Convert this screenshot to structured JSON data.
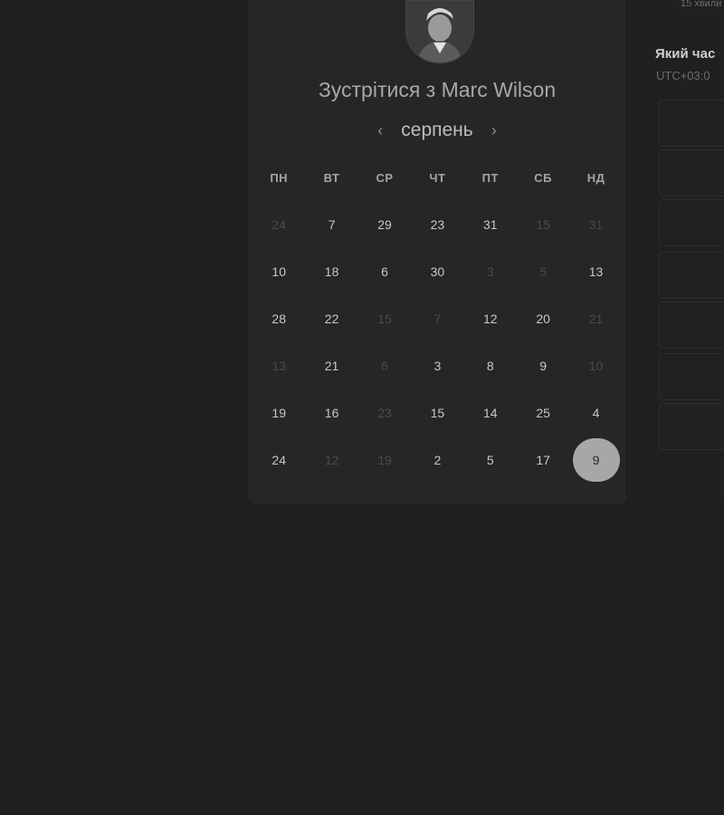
{
  "booking": {
    "title": "Зустрітися з Marc Wilson",
    "month": "серпень",
    "prev_icon": "chevron-left-icon",
    "next_icon": "chevron-right-icon",
    "weekdays": [
      "ПН",
      "ВТ",
      "СР",
      "ЧТ",
      "ПТ",
      "СБ",
      "НД"
    ],
    "days": [
      {
        "label": "24",
        "muted": true
      },
      {
        "label": "7",
        "muted": false
      },
      {
        "label": "29",
        "muted": false
      },
      {
        "label": "23",
        "muted": false
      },
      {
        "label": "31",
        "muted": false
      },
      {
        "label": "15",
        "muted": true
      },
      {
        "label": "31",
        "muted": true
      },
      {
        "label": "10",
        "muted": false
      },
      {
        "label": "18",
        "muted": false
      },
      {
        "label": "6",
        "muted": false
      },
      {
        "label": "30",
        "muted": false
      },
      {
        "label": "3",
        "muted": true
      },
      {
        "label": "5",
        "muted": true
      },
      {
        "label": "13",
        "muted": false
      },
      {
        "label": "28",
        "muted": false
      },
      {
        "label": "22",
        "muted": false
      },
      {
        "label": "15",
        "muted": true
      },
      {
        "label": "7",
        "muted": true
      },
      {
        "label": "12",
        "muted": false
      },
      {
        "label": "20",
        "muted": false
      },
      {
        "label": "21",
        "muted": true
      },
      {
        "label": "13",
        "muted": true
      },
      {
        "label": "21",
        "muted": false
      },
      {
        "label": "6",
        "muted": true
      },
      {
        "label": "3",
        "muted": false
      },
      {
        "label": "8",
        "muted": false
      },
      {
        "label": "9",
        "muted": false
      },
      {
        "label": "10",
        "muted": true
      },
      {
        "label": "19",
        "muted": false
      },
      {
        "label": "16",
        "muted": false
      },
      {
        "label": "23",
        "muted": true
      },
      {
        "label": "15",
        "muted": false
      },
      {
        "label": "14",
        "muted": false
      },
      {
        "label": "25",
        "muted": false
      },
      {
        "label": "4",
        "muted": false
      },
      {
        "label": "24",
        "muted": false
      },
      {
        "label": "12",
        "muted": true
      },
      {
        "label": "19",
        "muted": true
      },
      {
        "label": "2",
        "muted": false
      },
      {
        "label": "5",
        "muted": false
      },
      {
        "label": "17",
        "muted": false
      },
      {
        "label": "9",
        "muted": false,
        "selected": true
      }
    ]
  },
  "right_panel": {
    "duration": "15 хвили",
    "question": "Який час",
    "timezone": "UTC+03:0"
  },
  "colors": {
    "background": "#1e1e1e",
    "card": "#262626",
    "selected_day": "#a7a7a7"
  }
}
